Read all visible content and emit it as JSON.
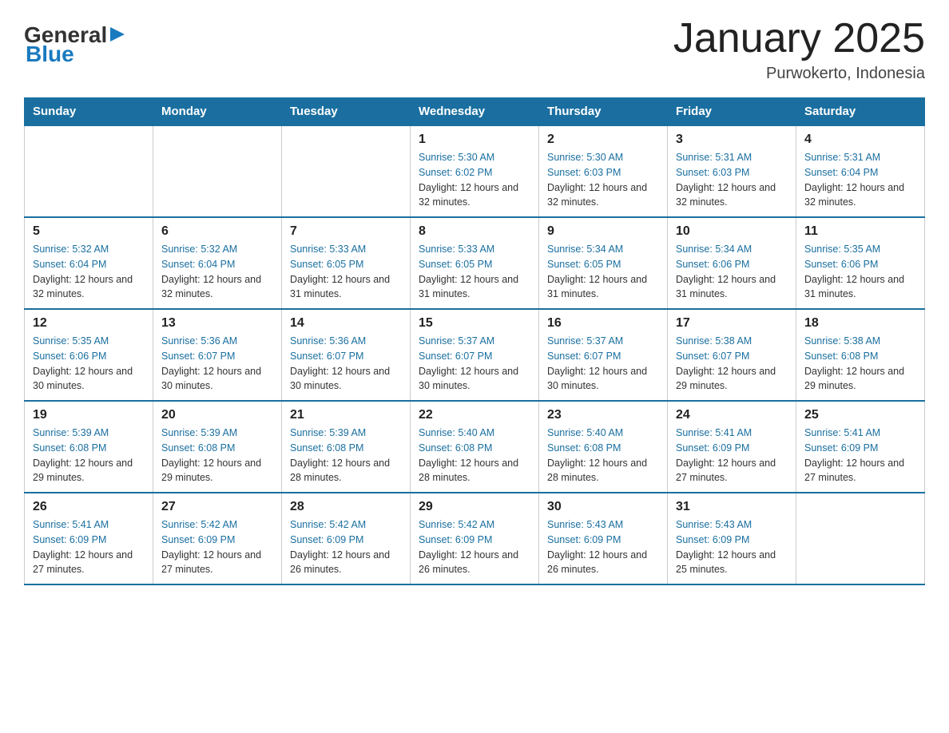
{
  "header": {
    "logo": {
      "general": "General",
      "blue": "Blue"
    },
    "title": "January 2025",
    "subtitle": "Purwokerto, Indonesia"
  },
  "calendar": {
    "days_of_week": [
      "Sunday",
      "Monday",
      "Tuesday",
      "Wednesday",
      "Thursday",
      "Friday",
      "Saturday"
    ],
    "weeks": [
      [
        {
          "day": "",
          "sunrise": "",
          "sunset": "",
          "daylight": ""
        },
        {
          "day": "",
          "sunrise": "",
          "sunset": "",
          "daylight": ""
        },
        {
          "day": "",
          "sunrise": "",
          "sunset": "",
          "daylight": ""
        },
        {
          "day": "1",
          "sunrise": "Sunrise: 5:30 AM",
          "sunset": "Sunset: 6:02 PM",
          "daylight": "Daylight: 12 hours and 32 minutes."
        },
        {
          "day": "2",
          "sunrise": "Sunrise: 5:30 AM",
          "sunset": "Sunset: 6:03 PM",
          "daylight": "Daylight: 12 hours and 32 minutes."
        },
        {
          "day": "3",
          "sunrise": "Sunrise: 5:31 AM",
          "sunset": "Sunset: 6:03 PM",
          "daylight": "Daylight: 12 hours and 32 minutes."
        },
        {
          "day": "4",
          "sunrise": "Sunrise: 5:31 AM",
          "sunset": "Sunset: 6:04 PM",
          "daylight": "Daylight: 12 hours and 32 minutes."
        }
      ],
      [
        {
          "day": "5",
          "sunrise": "Sunrise: 5:32 AM",
          "sunset": "Sunset: 6:04 PM",
          "daylight": "Daylight: 12 hours and 32 minutes."
        },
        {
          "day": "6",
          "sunrise": "Sunrise: 5:32 AM",
          "sunset": "Sunset: 6:04 PM",
          "daylight": "Daylight: 12 hours and 32 minutes."
        },
        {
          "day": "7",
          "sunrise": "Sunrise: 5:33 AM",
          "sunset": "Sunset: 6:05 PM",
          "daylight": "Daylight: 12 hours and 31 minutes."
        },
        {
          "day": "8",
          "sunrise": "Sunrise: 5:33 AM",
          "sunset": "Sunset: 6:05 PM",
          "daylight": "Daylight: 12 hours and 31 minutes."
        },
        {
          "day": "9",
          "sunrise": "Sunrise: 5:34 AM",
          "sunset": "Sunset: 6:05 PM",
          "daylight": "Daylight: 12 hours and 31 minutes."
        },
        {
          "day": "10",
          "sunrise": "Sunrise: 5:34 AM",
          "sunset": "Sunset: 6:06 PM",
          "daylight": "Daylight: 12 hours and 31 minutes."
        },
        {
          "day": "11",
          "sunrise": "Sunrise: 5:35 AM",
          "sunset": "Sunset: 6:06 PM",
          "daylight": "Daylight: 12 hours and 31 minutes."
        }
      ],
      [
        {
          "day": "12",
          "sunrise": "Sunrise: 5:35 AM",
          "sunset": "Sunset: 6:06 PM",
          "daylight": "Daylight: 12 hours and 30 minutes."
        },
        {
          "day": "13",
          "sunrise": "Sunrise: 5:36 AM",
          "sunset": "Sunset: 6:07 PM",
          "daylight": "Daylight: 12 hours and 30 minutes."
        },
        {
          "day": "14",
          "sunrise": "Sunrise: 5:36 AM",
          "sunset": "Sunset: 6:07 PM",
          "daylight": "Daylight: 12 hours and 30 minutes."
        },
        {
          "day": "15",
          "sunrise": "Sunrise: 5:37 AM",
          "sunset": "Sunset: 6:07 PM",
          "daylight": "Daylight: 12 hours and 30 minutes."
        },
        {
          "day": "16",
          "sunrise": "Sunrise: 5:37 AM",
          "sunset": "Sunset: 6:07 PM",
          "daylight": "Daylight: 12 hours and 30 minutes."
        },
        {
          "day": "17",
          "sunrise": "Sunrise: 5:38 AM",
          "sunset": "Sunset: 6:07 PM",
          "daylight": "Daylight: 12 hours and 29 minutes."
        },
        {
          "day": "18",
          "sunrise": "Sunrise: 5:38 AM",
          "sunset": "Sunset: 6:08 PM",
          "daylight": "Daylight: 12 hours and 29 minutes."
        }
      ],
      [
        {
          "day": "19",
          "sunrise": "Sunrise: 5:39 AM",
          "sunset": "Sunset: 6:08 PM",
          "daylight": "Daylight: 12 hours and 29 minutes."
        },
        {
          "day": "20",
          "sunrise": "Sunrise: 5:39 AM",
          "sunset": "Sunset: 6:08 PM",
          "daylight": "Daylight: 12 hours and 29 minutes."
        },
        {
          "day": "21",
          "sunrise": "Sunrise: 5:39 AM",
          "sunset": "Sunset: 6:08 PM",
          "daylight": "Daylight: 12 hours and 28 minutes."
        },
        {
          "day": "22",
          "sunrise": "Sunrise: 5:40 AM",
          "sunset": "Sunset: 6:08 PM",
          "daylight": "Daylight: 12 hours and 28 minutes."
        },
        {
          "day": "23",
          "sunrise": "Sunrise: 5:40 AM",
          "sunset": "Sunset: 6:08 PM",
          "daylight": "Daylight: 12 hours and 28 minutes."
        },
        {
          "day": "24",
          "sunrise": "Sunrise: 5:41 AM",
          "sunset": "Sunset: 6:09 PM",
          "daylight": "Daylight: 12 hours and 27 minutes."
        },
        {
          "day": "25",
          "sunrise": "Sunrise: 5:41 AM",
          "sunset": "Sunset: 6:09 PM",
          "daylight": "Daylight: 12 hours and 27 minutes."
        }
      ],
      [
        {
          "day": "26",
          "sunrise": "Sunrise: 5:41 AM",
          "sunset": "Sunset: 6:09 PM",
          "daylight": "Daylight: 12 hours and 27 minutes."
        },
        {
          "day": "27",
          "sunrise": "Sunrise: 5:42 AM",
          "sunset": "Sunset: 6:09 PM",
          "daylight": "Daylight: 12 hours and 27 minutes."
        },
        {
          "day": "28",
          "sunrise": "Sunrise: 5:42 AM",
          "sunset": "Sunset: 6:09 PM",
          "daylight": "Daylight: 12 hours and 26 minutes."
        },
        {
          "day": "29",
          "sunrise": "Sunrise: 5:42 AM",
          "sunset": "Sunset: 6:09 PM",
          "daylight": "Daylight: 12 hours and 26 minutes."
        },
        {
          "day": "30",
          "sunrise": "Sunrise: 5:43 AM",
          "sunset": "Sunset: 6:09 PM",
          "daylight": "Daylight: 12 hours and 26 minutes."
        },
        {
          "day": "31",
          "sunrise": "Sunrise: 5:43 AM",
          "sunset": "Sunset: 6:09 PM",
          "daylight": "Daylight: 12 hours and 25 minutes."
        },
        {
          "day": "",
          "sunrise": "",
          "sunset": "",
          "daylight": ""
        }
      ]
    ]
  }
}
